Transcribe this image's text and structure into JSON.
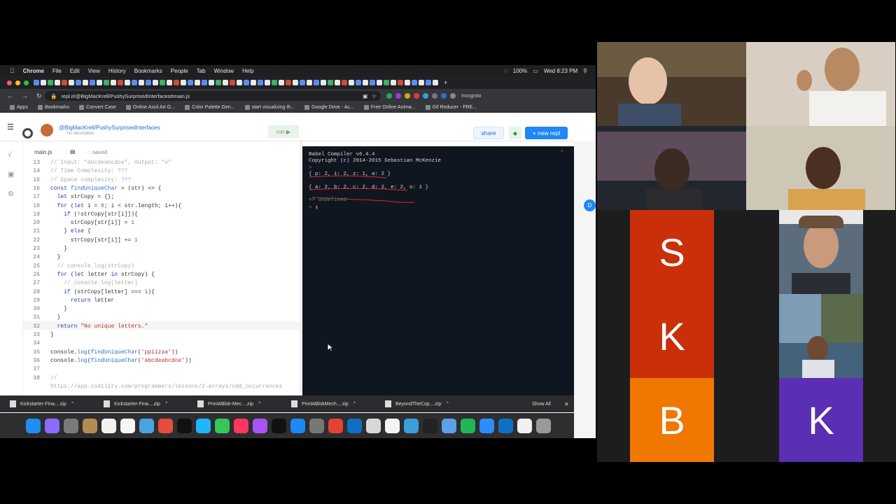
{
  "menubar": {
    "app": "Chrome",
    "items": [
      "File",
      "Edit",
      "View",
      "History",
      "Bookmarks",
      "People",
      "Tab",
      "Window",
      "Help"
    ],
    "battery": "100%",
    "clock": "Wed 8:23 PM"
  },
  "browser": {
    "url": "repl.it/@BigMacKrell/PushySurprisedInterfaces#main.js",
    "incognito": "Incognito",
    "bookmarks": [
      "Apps",
      "Bookmarks",
      "Convert Case",
      "Online Ascii Art G...",
      "Color Palette Gen...",
      "start visualizing th...",
      "Google Drive - Ac...",
      "Free Online Anima...",
      "Gif Reducer - FRE..."
    ]
  },
  "repl": {
    "path": "@BigMacKrell/PushySurprisedInterfaces",
    "description": "No description",
    "run_label": "run",
    "share_label": "share",
    "new_repl_label": "+ new repl",
    "file_tab": "main.js",
    "saved_label": "saved"
  },
  "editor": {
    "line_numbers": [
      "13",
      "14",
      "15",
      "16",
      "17",
      "18",
      "19",
      "20",
      "21",
      "22",
      "23",
      "24",
      "25",
      "26",
      "27",
      "28",
      "29",
      "30",
      "31",
      "32",
      "33",
      "34",
      "35",
      "36",
      "37",
      "38"
    ],
    "lines": [
      "// Input: \"abcdeabcdoe\", Output: \"o\"",
      "// Time Complexity: ???",
      "// Space complexity: ???",
      "const findUniqueChar = (str) => {",
      "  let strCopy = {};",
      "  for (let i = 0; i < str.length; i++){",
      "    if (!strCopy[str[i]]){",
      "      strCopy[str[i]] = 1",
      "    } else {",
      "      strCopy[str[i]] += 1",
      "    }",
      "  }",
      "  // console.log(strCopy)",
      "  for (let letter in strCopy) {",
      "    // console.log(letter)",
      "    if (strCopy[letter] === 1){",
      "      return letter",
      "    }",
      "  }",
      "  return \"No unique letters.\"",
      "}",
      "",
      "console.log(findUniqueChar('ppiizaa'))",
      "console.log(findUniqueChar('abcdeabcdoe'))",
      "",
      "//"
    ],
    "trailing_comment": "https://app.codility.com/programmers/lessons/2-arrays/odd_occurrences"
  },
  "console": {
    "header1": "Babel Compiler v6.4.4",
    "header2": "Copyright (c) 2014-2015 Sebastian McKenzie",
    "prompt": ">",
    "out1": "{ p: 2, i: 2, z: 1, a: 2 }",
    "out2": "{ a: 2, b: 2, c: 2, d: 2, e: 2, o: 1 }",
    "result_arrow": "=>",
    "result": "undefined"
  },
  "downloads": {
    "items": [
      "Kickstarter-Fina....zip",
      "Kickstarter-Fina....zip",
      "PrintABlok-Mec....zip",
      "PrintABlokMech....zip",
      "BeyondTheCop....zip"
    ],
    "show_all": "Show All"
  },
  "participants": {
    "tiles": [
      "S",
      "K",
      "B",
      "K"
    ]
  },
  "colors": {
    "tile_s": "#c9300a",
    "tile_k": "#c9300a",
    "tile_b": "#f07800",
    "tile_k2": "#5a2fb3",
    "accent": "#1e88f5"
  }
}
